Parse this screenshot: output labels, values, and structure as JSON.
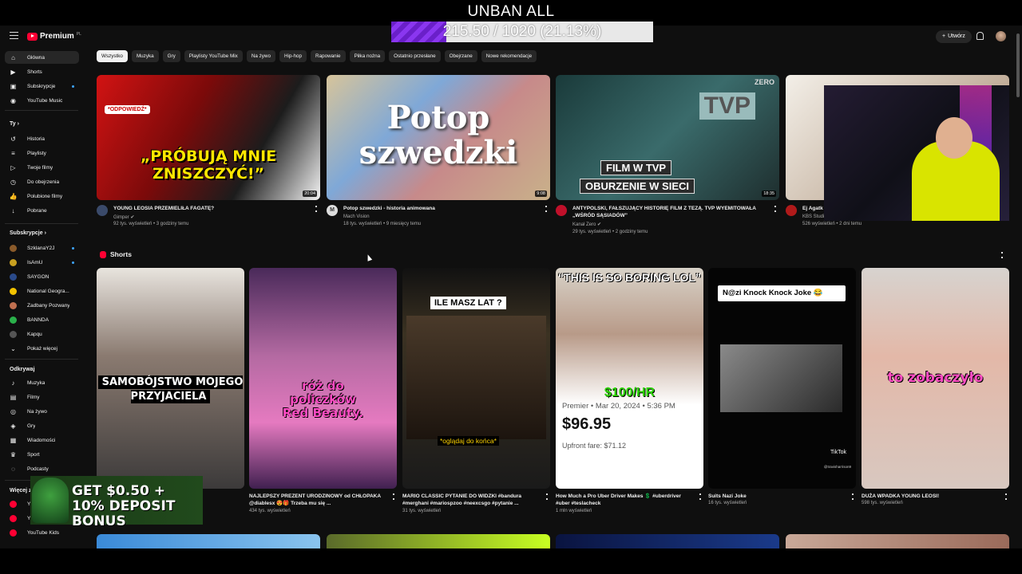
{
  "overlay": {
    "title": "UNBAN ALL",
    "progress_text": "215.50 / 1020 (21.13%)",
    "progress_fraction": 0.2113,
    "accent": "#7b2ee0"
  },
  "topbar": {
    "brand": "Premium",
    "country": "PL",
    "create_label": "Utwórz",
    "create_icon": "plus-icon",
    "notifications_icon": "bell-icon"
  },
  "sidebar": {
    "main": [
      {
        "label": "Główna",
        "icon": "home-icon",
        "active": true
      },
      {
        "label": "Shorts",
        "icon": "shorts-icon"
      },
      {
        "label": "Subskrypcje",
        "icon": "subscriptions-icon",
        "dot": true
      },
      {
        "label": "YouTube Music",
        "icon": "music-icon"
      }
    ],
    "you_heading": "Ty",
    "you": [
      {
        "label": "Historia",
        "icon": "history-icon"
      },
      {
        "label": "Playlisty",
        "icon": "playlists-icon"
      },
      {
        "label": "Twoje filmy",
        "icon": "your-videos-icon"
      },
      {
        "label": "Do obejrzenia",
        "icon": "watch-later-icon"
      },
      {
        "label": "Polubione filmy",
        "icon": "like-icon"
      },
      {
        "label": "Pobrane",
        "icon": "download-icon"
      }
    ],
    "subs_heading": "Subskrypcje",
    "subs": [
      {
        "label": "SzklanaY2J",
        "color": "#8a5a2a",
        "dot": true
      },
      {
        "label": "IsAmU",
        "color": "#c8a020",
        "dot": true
      },
      {
        "label": "SAYGON",
        "color": "#2a4a8a"
      },
      {
        "label": "National Geogra...",
        "color": "#f2c200"
      },
      {
        "label": "Zadbany Pozwany",
        "color": "#c07050"
      },
      {
        "label": "BANNDA",
        "color": "#2ab04a"
      },
      {
        "label": "Kapqu",
        "color": "#555555"
      }
    ],
    "show_more": "Pokaż więcej",
    "discover_heading": "Odkrywaj",
    "discover": [
      {
        "label": "Muzyka",
        "icon": "music-note-icon"
      },
      {
        "label": "Filmy",
        "icon": "film-icon"
      },
      {
        "label": "Na żywo",
        "icon": "live-icon"
      },
      {
        "label": "Gry",
        "icon": "gaming-icon"
      },
      {
        "label": "Wiadomości",
        "icon": "news-icon"
      },
      {
        "label": "Sport",
        "icon": "trophy-icon"
      },
      {
        "label": "Podcasty",
        "icon": "podcast-icon"
      }
    ],
    "more_heading": "Więcej z",
    "more": [
      {
        "label": "Y"
      },
      {
        "label": "Y"
      },
      {
        "label": "YouTube Kids"
      }
    ]
  },
  "chips": [
    "Wszystko",
    "Muzyka",
    "Gry",
    "Playlisty YouTube Mix",
    "Na żywo",
    "Hip-hop",
    "Rapowanie",
    "Piłka nożna",
    "Ostatnio przesłane",
    "Obejrzane",
    "Nowe rekomendacje"
  ],
  "videos": [
    {
      "title": "YOUNG LEOSIA PRZEMIELIŁA FAGATĘ?",
      "channel": "Gimper",
      "verified": true,
      "meta": "92 tys. wyświetleń • 3 godziny temu",
      "duration": "20:04",
      "thumb_text": "„PRÓBUJĄ MNIE ZNISZCZYĆ!”",
      "thumb_badge": "*ODPOWIEDŹ*",
      "avatar_color": "#3a4a6a"
    },
    {
      "title": "Potop szwedzki - historia animowana",
      "channel": "Mach Vision",
      "verified": false,
      "meta": "18 tys. wyświetleń • 9 miesięcy temu",
      "duration": "9:08",
      "thumb_text": "Potop szwedzki",
      "avatar_color": "#dddddd",
      "avatar_letter": "M"
    },
    {
      "title": "ANTYPOLSKI, FAŁSZUJĄCY HISTORIĘ FILM Z TEZĄ. TVP WYEMITOWAŁA „WŚRÓD SĄSIADÓW”",
      "channel": "Kanał Zero",
      "verified": true,
      "meta": "29 tys. wyświetleń • 2 godziny temu",
      "duration": "18:35",
      "thumb_text_a": "FILM W TVP",
      "thumb_text_b": "OBURZENIE W SIECI",
      "thumb_tvp": "TVP",
      "thumb_brand": "ZERO",
      "avatar_color": "#c0102a"
    },
    {
      "title": "Ej Agatk",
      "channel": "KBS Studi",
      "verified": false,
      "meta": "526 wyświetleń • 2 dni temu",
      "avatar_color": "#b01a1a"
    }
  ],
  "shorts": {
    "heading": "Shorts",
    "items": [
      {
        "title": "",
        "views": "",
        "caption": "SAMOBÓJSTWO MOJEGO PRZYJACIELA"
      },
      {
        "title": "NAJLEPSZY PREZENT URODZINOWY od CHŁOPAKA @diablesx 😍🎁 Trzeba mu się ...",
        "views": "434 tys. wyświetleń",
        "caption": "róż do policzków Red Beauty."
      },
      {
        "title": "MARIO CLASSIC PYTANIE DO WIDZKI #bandura #merghani #mariospzoo #neexcsgo #pytanie ...",
        "views": "31 tys. wyświetleń",
        "caption_top": "ILE MASZ LAT ?",
        "caption_bottom": "*oglądaj do końca*"
      },
      {
        "title": "How Much a Pro Uber Driver Makes 💲 #uberdriver #uber #teslacheck",
        "views": "1 mln wyświetleń",
        "caption_head": "“THIS IS SO BORING LOL”",
        "caption_hr": "$100/HR",
        "premier": "Premier • Mar 20, 2024 • 5:36 PM",
        "price": "$96.95",
        "fare": "Upfront fare: $71.12"
      },
      {
        "title": "Suits Nazi Joke",
        "views": "16 tys. wyświetleń",
        "caption": "N@zi Knock Knock Joke 😂",
        "tiktok": "TikTok",
        "tiktok_user": "@travisharrison9"
      },
      {
        "title": "DUŻA WPADKA YOUNG LEOSI!",
        "views": "598 tys. wyświetleń",
        "caption": "to zobaczyło"
      }
    ]
  },
  "deposit": {
    "text": "GET $0.50 + 10% DEPOSIT BONUS"
  }
}
